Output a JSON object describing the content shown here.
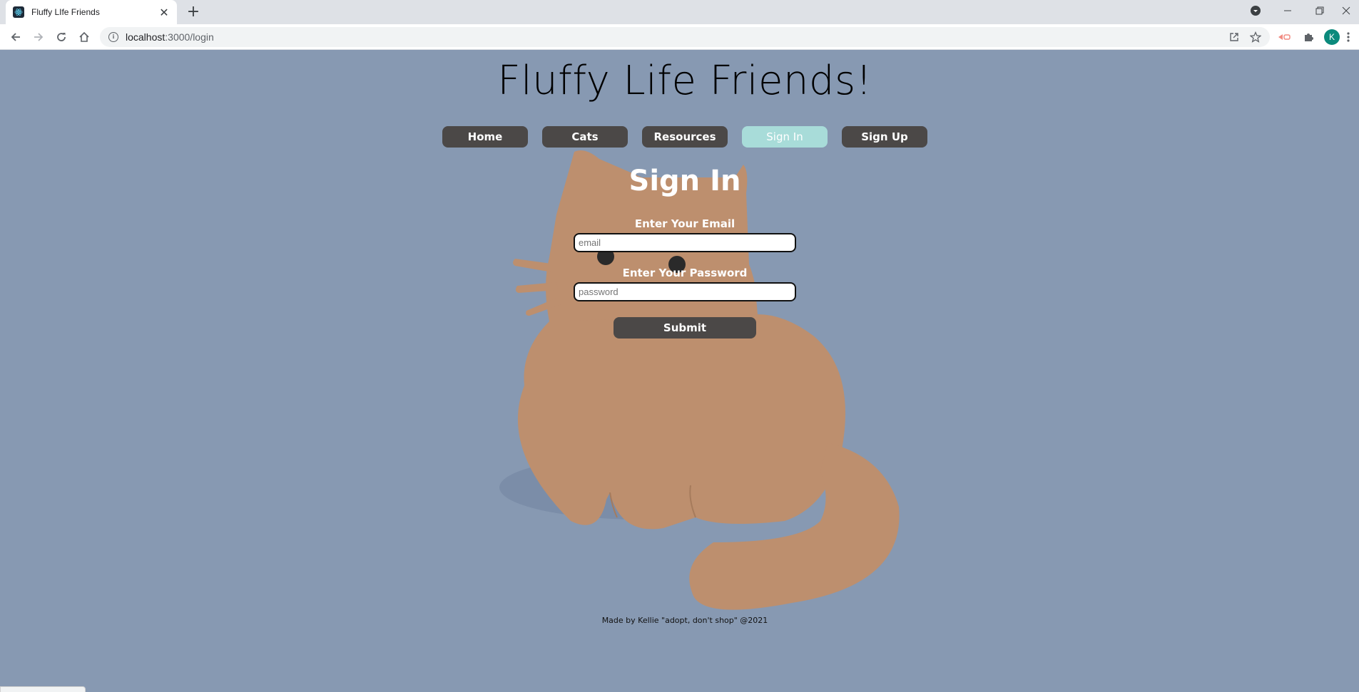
{
  "browser": {
    "tab_title": "Fluffy LIfe Friends",
    "url_host": "localhost",
    "url_path": ":3000/login",
    "new_tab_icon": "+",
    "avatar_initial": "K"
  },
  "site": {
    "title": "Fluffy Life Friends!",
    "nav": [
      {
        "label": "Home"
      },
      {
        "label": "Cats"
      },
      {
        "label": "Resources"
      },
      {
        "label": "Sign In",
        "active": true
      },
      {
        "label": "Sign Up"
      }
    ]
  },
  "signin": {
    "heading": "Sign In",
    "email_label": "Enter Your Email",
    "email_placeholder": "email",
    "password_label": "Enter Your Password",
    "password_placeholder": "password",
    "submit_label": "Submit"
  },
  "footer": {
    "text": "Made by Kellie \"adopt, don't shop\" @2021"
  },
  "colors": {
    "page_bg": "#8799b2",
    "nav_button": "#4b4847",
    "nav_active": "#a8dcd9",
    "cat": "#bd8f6e",
    "cat_shadow": "#7b8da8"
  }
}
